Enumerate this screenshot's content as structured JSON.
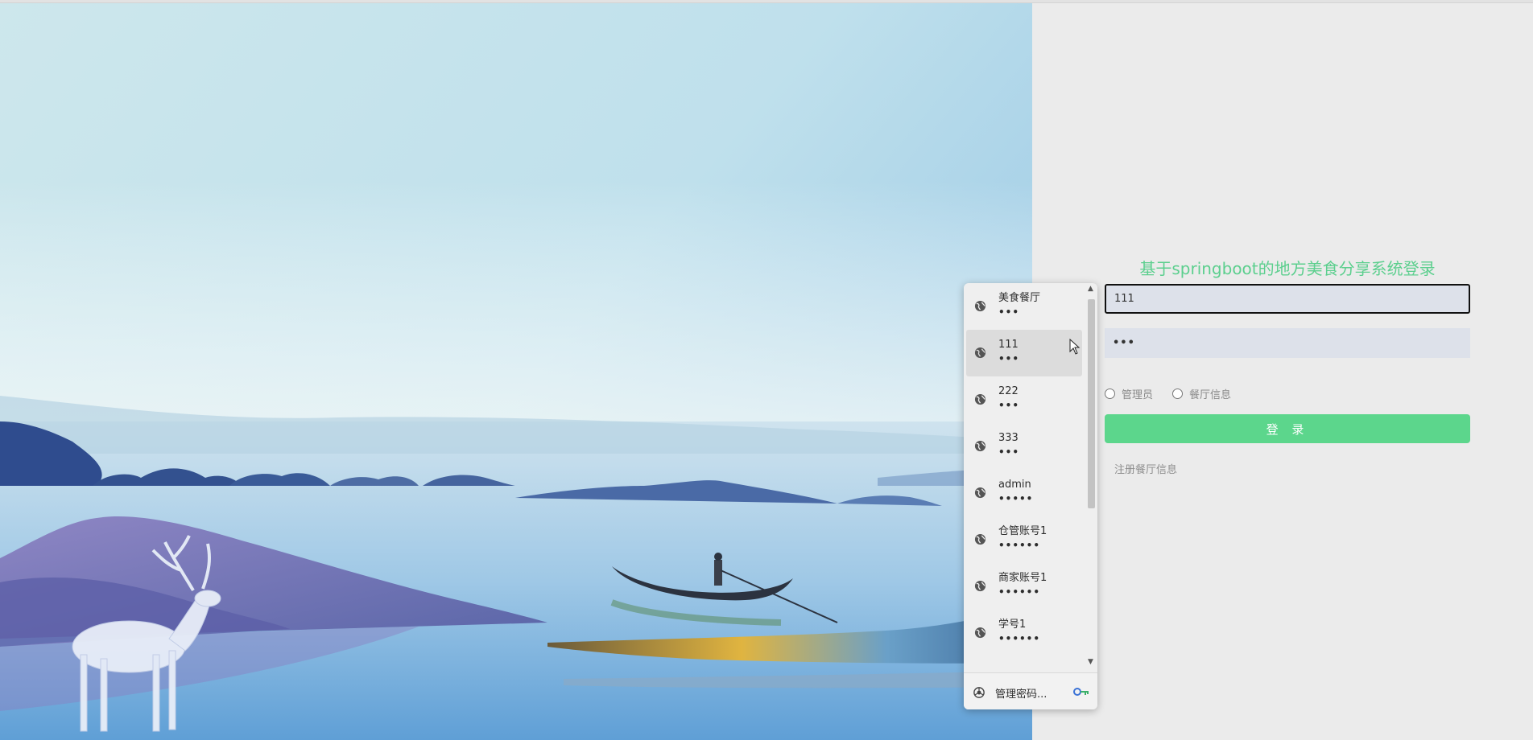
{
  "login": {
    "title": "基于springboot的地方美食分享系统登录",
    "username_value": "111",
    "password_value": "•••",
    "roles": [
      {
        "label": "管理员"
      },
      {
        "label": "餐厅信息"
      }
    ],
    "login_button": "登 录",
    "register_link": "注册餐厅信息"
  },
  "autofill": {
    "items": [
      {
        "username": "美食餐厅",
        "password": "•••"
      },
      {
        "username": "111",
        "password": "•••"
      },
      {
        "username": "222",
        "password": "•••"
      },
      {
        "username": "333",
        "password": "•••"
      },
      {
        "username": "admin",
        "password": "•••••"
      },
      {
        "username": "仓管账号1",
        "password": "••••••"
      },
      {
        "username": "商家账号1",
        "password": "••••••"
      },
      {
        "username": "学号1",
        "password": "••••••"
      },
      {
        "username": "",
        "password": ""
      }
    ],
    "manage_label": "管理密码...",
    "scroll_up": "▲",
    "scroll_down": "▼"
  },
  "colors": {
    "accent": "#5cd68c",
    "title": "#5ccf8e",
    "input_bg": "#dde1ea",
    "page_bg": "#ebebeb"
  }
}
